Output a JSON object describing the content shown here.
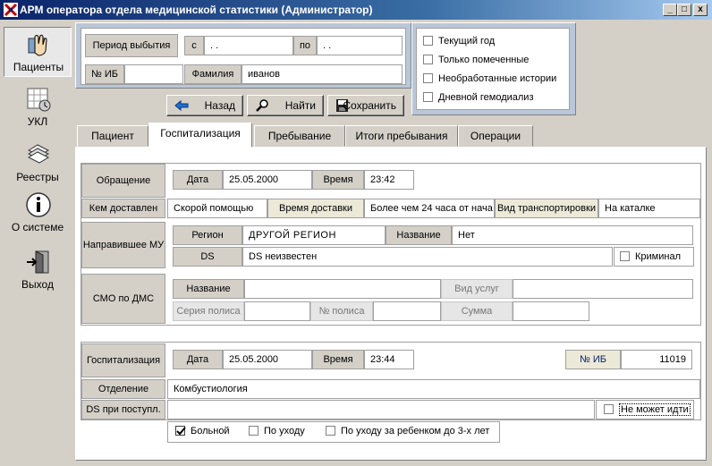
{
  "window": {
    "title": "АРМ оператора отдела медицинской статистики (Администратор)",
    "min": "_",
    "max": "□",
    "close": "x"
  },
  "sidebar": [
    {
      "label": "Пациенты",
      "icon": "patients-icon"
    },
    {
      "label": "УКЛ",
      "icon": "ukl-icon"
    },
    {
      "label": "Реестры",
      "icon": "registry-icon"
    },
    {
      "label": "О системе",
      "icon": "info-icon"
    },
    {
      "label": "Выход",
      "icon": "exit-icon"
    }
  ],
  "filter": {
    "period_label": "Период выбытия",
    "from_label": "с",
    "from_value": " .  .",
    "to_label": "по",
    "to_value": " .  .",
    "ib_label": "№ ИБ",
    "ib_value": "",
    "surname_label": "Фамилия",
    "surname_value": "иванов"
  },
  "options": [
    "Текущий год",
    "Только помеченные",
    "Необработанные истории",
    "Дневной гемодиализ"
  ],
  "buttons": {
    "back": "Назад",
    "find": "Найти",
    "save": "Сохранить"
  },
  "tabs": [
    "Пациент",
    "Госпитализация",
    "Пребывание",
    "Итоги пребывания",
    "Операции"
  ],
  "hosp": {
    "appeal_label": "Обращение",
    "date_label": "Дата",
    "date_value": "25.05.2000",
    "time_label": "Время",
    "time_value": "23:42",
    "delivered_label": "Кем доставлен",
    "delivered_value": "Скорой помощью",
    "deliv_time_label": "Время доставки",
    "deliv_time_value": "Более чем 24 часа от нача",
    "transport_label": "Вид транспортировки",
    "transport_value": "На каталке",
    "sender_label": "Направившее МУ",
    "region_label": "Регион",
    "region_value": "ДРУГОЙ  РЕГИОН",
    "name_label": "Название",
    "name_value": "Нет",
    "ds_label": "DS",
    "ds_value": "DS неизвестен",
    "criminal_label": "Криминал",
    "smo_label": "СМО по ДМС",
    "smo_name_label": "Название",
    "smo_name_value": "",
    "service_label": "Вид услуг",
    "series_label": "Серия полиса",
    "policy_label": "№ полиса",
    "sum_label": "Сумма",
    "hosp_label": "Госпитализация",
    "hosp_date_label": "Дата",
    "hosp_date_value": "25.05.2000",
    "hosp_time_label": "Время",
    "hosp_time_value": "23:44",
    "hosp_ib_label": "№ ИБ",
    "hosp_ib_value": "11019",
    "dept_label": "Отделение",
    "dept_value": "Комбустиология",
    "ds_in_label": "DS при поступл.",
    "cannot_walk_label": "Не может идти",
    "patient_type": [
      "Больной",
      "По уходу",
      "По уходу за ребенком до 3-х лет"
    ]
  }
}
